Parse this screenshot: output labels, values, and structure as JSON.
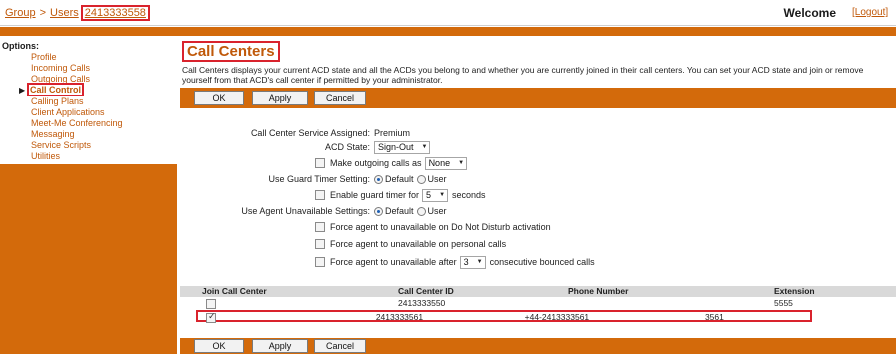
{
  "header": {
    "breadcrumb": [
      "Group",
      "Users"
    ],
    "breadcrumb_sep": ">",
    "user_id": "2413333558",
    "welcome": "Welcome",
    "logout": "[Logout]"
  },
  "sidebar": {
    "heading": "Options:",
    "items": [
      {
        "label": "Profile"
      },
      {
        "label": "Incoming Calls"
      },
      {
        "label": "Outgoing Calls"
      },
      {
        "label": "Call Control"
      },
      {
        "label": "Calling Plans"
      },
      {
        "label": "Client Applications"
      },
      {
        "label": "Meet-Me Conferencing"
      },
      {
        "label": "Messaging"
      },
      {
        "label": "Service Scripts"
      },
      {
        "label": "Utilities"
      }
    ]
  },
  "page": {
    "title": "Call Centers",
    "description": "Call Centers displays your current ACD state and all the ACDs you belong to and whether you are currently joined in their call centers. You can set your ACD state and join or remove yourself from that ACD's call center if permitted by your administrator."
  },
  "buttons": {
    "ok": "OK",
    "apply": "Apply",
    "cancel": "Cancel"
  },
  "form": {
    "service_assigned_label": "Call Center Service Assigned:",
    "service_assigned_value": "Premium",
    "acd_state_label": "ACD State:",
    "acd_state_value": "Sign-Out",
    "outgoing_as_label": "Make outgoing calls as",
    "outgoing_as_value": "None",
    "guard_timer_label": "Use Guard Timer Setting:",
    "default_label": "Default",
    "user_label": "User",
    "enable_guard_label": "Enable guard timer for",
    "guard_seconds_value": "5",
    "seconds_label": "seconds",
    "unavailable_label": "Use Agent Unavailable Settings:",
    "dnd_label": "Force agent to unavailable on Do Not Disturb activation",
    "personal_label": "Force agent to unavailable on personal calls",
    "after_label": "Force agent to unavailable after",
    "bounced_value": "3",
    "bounced_label": "consecutive bounced calls"
  },
  "table": {
    "headers": [
      "Join Call Center",
      "Call Center ID",
      "Phone Number",
      "Extension"
    ],
    "rows": [
      {
        "joined": false,
        "id": "2413333550",
        "phone": "",
        "extension": "5555"
      },
      {
        "joined": true,
        "id": "2413333561",
        "phone": "+44-2413333561",
        "extension": "3561"
      }
    ]
  }
}
